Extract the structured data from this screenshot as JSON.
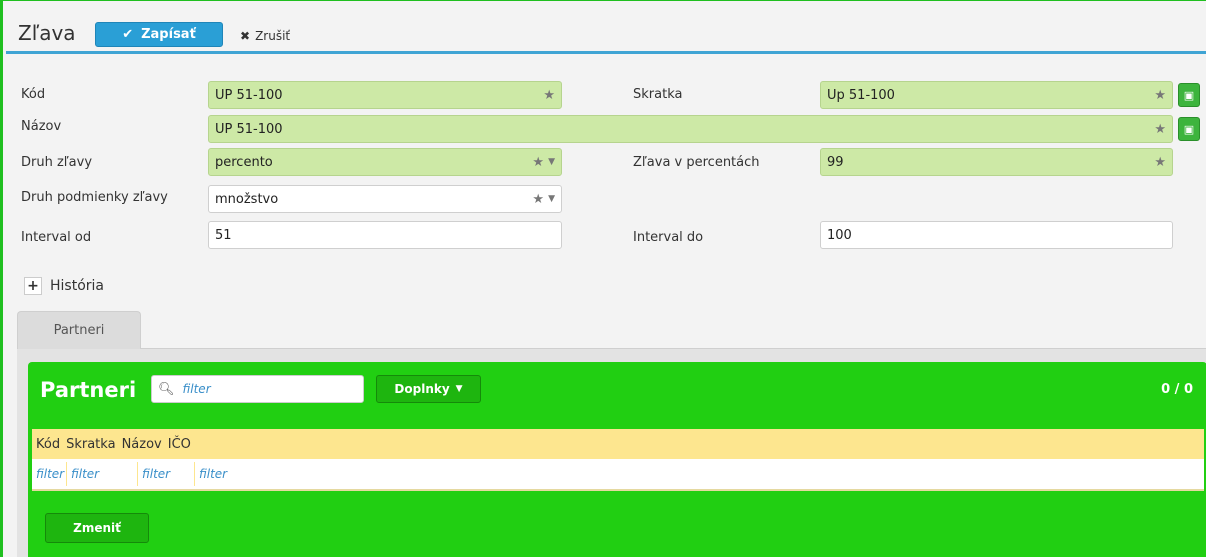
{
  "header": {
    "title": "Zľava",
    "save_label": "Zapísať",
    "cancel_label": "Zrušiť"
  },
  "form": {
    "kod": {
      "label": "Kód",
      "value": "UP 51-100"
    },
    "skratka": {
      "label": "Skratka",
      "value": "Up 51-100"
    },
    "nazov": {
      "label": "Názov",
      "value": "UP 51-100"
    },
    "druh_zlavy": {
      "label": "Druh zľavy",
      "value": "percento"
    },
    "zlava_percent": {
      "label": "Zľava v percentách",
      "value": "99"
    },
    "druh_podmienky": {
      "label": "Druh podmienky zľavy",
      "value": "množstvo"
    },
    "interval_od": {
      "label": "Interval od",
      "value": "51"
    },
    "interval_do": {
      "label": "Interval do",
      "value": "100"
    }
  },
  "history": {
    "label": "História"
  },
  "tabs": [
    {
      "label": "Partneri"
    }
  ],
  "partners": {
    "title": "Partneri",
    "search_placeholder": "filter",
    "dropdown_label": "Doplnky",
    "count": "0 / 0",
    "columns": [
      "Kód",
      "Skratka",
      "Názov",
      "IČO"
    ],
    "filters": [
      "filter",
      "filter",
      "filter",
      "filter"
    ],
    "change_label": "Zmeniť"
  },
  "colors": {
    "accent_blue": "#2a9fd6",
    "panel_green": "#21cf12",
    "required_field": "#cde9a6",
    "grid_header": "#fde68f"
  }
}
